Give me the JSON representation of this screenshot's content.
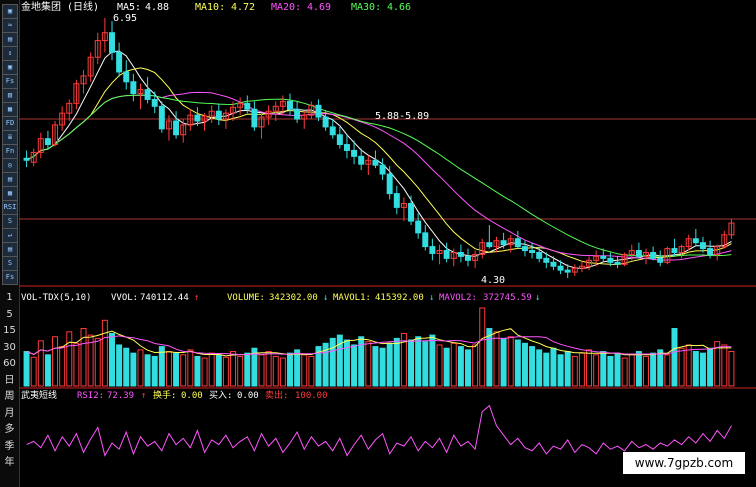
{
  "price_panel": {
    "title": "金地集团 (日线)",
    "ma5_label": "MA5:",
    "ma5_value": "4.88",
    "ma10_label": "MA10:",
    "ma10_value": "4.72",
    "ma20_label": "MA20:",
    "ma20_value": "4.69",
    "ma30_label": "MA30:",
    "ma30_value": "4.66",
    "high_label": "6.95",
    "range_label": "5.88-5.89",
    "low_label": "4.30"
  },
  "volume_panel": {
    "title": "VOL-TDX(5,10)",
    "vvol_label": "VVOL:",
    "vvol_value": "740112.44",
    "volume_label": "VOLUME:",
    "volume_value": "342302.00",
    "mavol1_label": "MAVOL1:",
    "mavol1_value": "415392.00",
    "mavol2_label": "MAVOL2:",
    "mavol2_value": "372745.59",
    "arrow_up": "↑",
    "arrow_down": "↓"
  },
  "indicator_panel": {
    "title": "武夷短线",
    "rsi_label": "RSI2:",
    "rsi_value": "72.39",
    "sw_label": "换手:",
    "sw_value": "0.00",
    "buy_label": "买入:",
    "buy_value": "0.00",
    "sell_label": "卖出:",
    "sell_value": "100.00"
  },
  "toolbar": {
    "buttons": [
      "▣",
      "≈",
      "▤",
      "↕",
      "▣",
      "Fs",
      "▥",
      "▦",
      "FD",
      "≣",
      "Fn",
      "◎",
      "▤",
      "▦",
      "RSI",
      "S",
      "↵",
      "▤",
      "S",
      "Fs"
    ],
    "labels": [
      "1",
      "5",
      "15",
      "30",
      "60",
      "日",
      "周",
      "月",
      "多",
      "季",
      "年"
    ]
  },
  "watermark": "www.7gpzb.com",
  "colors": {
    "up": "#ff3b3b",
    "down": "#33dde0",
    "ma5": "#ffffff",
    "ma10": "#ffff55",
    "ma20": "#ff55ff",
    "ma30": "#55ff55",
    "rsi": "#ff55ff",
    "signal": "#ffff88"
  },
  "chart_data": {
    "type": "candlestick",
    "x": "trading days (no dates printed)",
    "price_range": [
      4.3,
      6.95
    ],
    "candles_ohlc": [
      [
        5.52,
        5.6,
        5.43,
        5.5
      ],
      [
        5.48,
        5.62,
        5.44,
        5.58
      ],
      [
        5.58,
        5.78,
        5.52,
        5.72
      ],
      [
        5.72,
        5.8,
        5.62,
        5.66
      ],
      [
        5.66,
        5.9,
        5.64,
        5.86
      ],
      [
        5.86,
        6.05,
        5.8,
        5.98
      ],
      [
        5.98,
        6.12,
        5.9,
        6.08
      ],
      [
        6.08,
        6.32,
        6.02,
        6.28
      ],
      [
        6.28,
        6.42,
        6.18,
        6.36
      ],
      [
        6.36,
        6.6,
        6.3,
        6.55
      ],
      [
        6.55,
        6.8,
        6.48,
        6.72
      ],
      [
        6.72,
        6.95,
        6.6,
        6.8
      ],
      [
        6.8,
        6.92,
        6.52,
        6.6
      ],
      [
        6.6,
        6.7,
        6.35,
        6.4
      ],
      [
        6.4,
        6.52,
        6.22,
        6.3
      ],
      [
        6.3,
        6.38,
        6.1,
        6.18
      ],
      [
        6.18,
        6.28,
        6.02,
        6.22
      ],
      [
        6.22,
        6.35,
        6.08,
        6.12
      ],
      [
        6.12,
        6.2,
        5.98,
        6.05
      ],
      [
        6.05,
        6.1,
        5.78,
        5.82
      ],
      [
        5.82,
        5.96,
        5.7,
        5.9
      ],
      [
        5.9,
        6.0,
        5.72,
        5.76
      ],
      [
        5.76,
        5.92,
        5.68,
        5.86
      ],
      [
        5.86,
        6.02,
        5.8,
        5.96
      ],
      [
        5.96,
        6.04,
        5.85,
        5.9
      ],
      [
        5.9,
        5.98,
        5.8,
        5.95
      ],
      [
        5.95,
        6.06,
        5.88,
        6.0
      ],
      [
        6.0,
        6.08,
        5.86,
        5.92
      ],
      [
        5.92,
        6.02,
        5.82,
        5.98
      ],
      [
        5.98,
        6.1,
        5.9,
        6.04
      ],
      [
        6.04,
        6.14,
        5.96,
        6.08
      ],
      [
        6.08,
        6.16,
        5.98,
        6.02
      ],
      [
        6.02,
        6.1,
        5.8,
        5.84
      ],
      [
        5.84,
        5.98,
        5.72,
        5.94
      ],
      [
        5.94,
        6.06,
        5.86,
        6.0
      ],
      [
        6.0,
        6.1,
        5.9,
        6.05
      ],
      [
        6.05,
        6.16,
        5.96,
        6.1
      ],
      [
        6.1,
        6.18,
        5.96,
        6.02
      ],
      [
        6.02,
        6.1,
        5.88,
        5.92
      ],
      [
        5.92,
        6.0,
        5.82,
        5.96
      ],
      [
        5.96,
        6.1,
        5.92,
        6.06
      ],
      [
        6.06,
        6.12,
        5.9,
        5.94
      ],
      [
        5.94,
        6.0,
        5.8,
        5.84
      ],
      [
        5.84,
        5.92,
        5.72,
        5.76
      ],
      [
        5.76,
        5.84,
        5.62,
        5.66
      ],
      [
        5.66,
        5.76,
        5.52,
        5.6
      ],
      [
        5.6,
        5.7,
        5.46,
        5.54
      ],
      [
        5.54,
        5.62,
        5.4,
        5.46
      ],
      [
        5.46,
        5.55,
        5.35,
        5.5
      ],
      [
        5.5,
        5.6,
        5.42,
        5.45
      ],
      [
        5.45,
        5.52,
        5.3,
        5.36
      ],
      [
        5.36,
        5.44,
        5.1,
        5.16
      ],
      [
        5.16,
        5.24,
        4.95,
        5.02
      ],
      [
        5.02,
        5.12,
        4.88,
        5.06
      ],
      [
        5.06,
        5.14,
        4.84,
        4.88
      ],
      [
        4.88,
        4.96,
        4.7,
        4.76
      ],
      [
        4.76,
        4.84,
        4.58,
        4.62
      ],
      [
        4.62,
        4.7,
        4.48,
        4.55
      ],
      [
        4.55,
        4.64,
        4.44,
        4.58
      ],
      [
        4.58,
        4.66,
        4.46,
        4.5
      ],
      [
        4.5,
        4.6,
        4.42,
        4.56
      ],
      [
        4.56,
        4.64,
        4.46,
        4.52
      ],
      [
        4.52,
        4.6,
        4.42,
        4.48
      ],
      [
        4.48,
        4.58,
        4.4,
        4.54
      ],
      [
        4.54,
        4.7,
        4.5,
        4.66
      ],
      [
        4.66,
        4.84,
        4.6,
        4.62
      ],
      [
        4.62,
        4.72,
        4.56,
        4.68
      ],
      [
        4.68,
        4.76,
        4.6,
        4.64
      ],
      [
        4.64,
        4.74,
        4.56,
        4.7
      ],
      [
        4.7,
        4.78,
        4.6,
        4.62
      ],
      [
        4.62,
        4.68,
        4.52,
        4.58
      ],
      [
        4.58,
        4.66,
        4.5,
        4.56
      ],
      [
        4.56,
        4.62,
        4.46,
        4.5
      ],
      [
        4.5,
        4.56,
        4.4,
        4.46
      ],
      [
        4.46,
        4.52,
        4.38,
        4.42
      ],
      [
        4.42,
        4.48,
        4.34,
        4.38
      ],
      [
        4.38,
        4.44,
        4.3,
        4.36
      ],
      [
        4.36,
        4.44,
        4.32,
        4.4
      ],
      [
        4.4,
        4.48,
        4.36,
        4.42
      ],
      [
        4.42,
        4.52,
        4.38,
        4.48
      ],
      [
        4.48,
        4.58,
        4.42,
        4.52
      ],
      [
        4.52,
        4.6,
        4.46,
        4.5
      ],
      [
        4.5,
        4.56,
        4.42,
        4.46
      ],
      [
        4.46,
        4.52,
        4.4,
        4.44
      ],
      [
        4.44,
        4.56,
        4.42,
        4.54
      ],
      [
        4.54,
        4.64,
        4.48,
        4.58
      ],
      [
        4.58,
        4.66,
        4.5,
        4.52
      ],
      [
        4.52,
        4.6,
        4.44,
        4.56
      ],
      [
        4.56,
        4.62,
        4.48,
        4.5
      ],
      [
        4.5,
        4.58,
        4.42,
        4.46
      ],
      [
        4.46,
        4.62,
        4.44,
        4.6
      ],
      [
        4.6,
        4.7,
        4.52,
        4.56
      ],
      [
        4.56,
        4.64,
        4.5,
        4.62
      ],
      [
        4.62,
        4.74,
        4.58,
        4.7
      ],
      [
        4.7,
        4.8,
        4.62,
        4.66
      ],
      [
        4.66,
        4.72,
        4.56,
        4.6
      ],
      [
        4.6,
        4.68,
        4.5,
        4.54
      ],
      [
        4.54,
        4.64,
        4.48,
        4.62
      ],
      [
        4.62,
        4.78,
        4.6,
        4.74
      ],
      [
        4.74,
        4.9,
        4.7,
        4.86
      ]
    ],
    "volume": [
      42,
      35,
      55,
      38,
      60,
      48,
      66,
      52,
      70,
      62,
      58,
      80,
      64,
      50,
      46,
      40,
      44,
      38,
      36,
      48,
      42,
      40,
      38,
      44,
      36,
      34,
      40,
      38,
      35,
      42,
      36,
      40,
      46,
      38,
      42,
      36,
      34,
      40,
      44,
      38,
      36,
      48,
      52,
      58,
      62,
      56,
      50,
      60,
      54,
      48,
      46,
      52,
      58,
      64,
      56,
      60,
      54,
      62,
      50,
      46,
      52,
      48,
      44,
      50,
      95,
      70,
      66,
      58,
      60,
      56,
      52,
      48,
      44,
      40,
      46,
      38,
      42,
      36,
      40,
      44,
      38,
      42,
      36,
      40,
      34,
      38,
      42,
      36,
      40,
      44,
      38,
      70,
      46,
      50,
      42,
      40,
      46,
      54,
      50,
      42
    ],
    "rsi2": [
      48,
      52,
      44,
      60,
      40,
      58,
      46,
      62,
      38,
      55,
      70,
      34,
      50,
      42,
      64,
      36,
      58,
      46,
      52,
      40,
      62,
      48,
      56,
      44,
      66,
      38,
      54,
      48,
      60,
      44,
      52,
      58,
      40,
      62,
      46,
      56,
      38,
      50,
      64,
      42,
      58,
      46,
      52,
      40,
      56,
      34,
      48,
      60,
      42,
      54,
      62,
      36,
      50,
      46,
      58,
      40,
      52,
      44,
      56,
      38,
      60,
      46,
      52,
      42,
      90,
      98,
      72,
      60,
      48,
      56,
      44,
      40,
      50,
      36,
      46,
      42,
      54,
      38,
      48,
      44,
      36,
      50,
      42,
      46,
      40,
      52,
      44,
      48,
      42,
      50,
      46,
      54,
      48,
      58,
      50,
      62,
      52,
      66,
      56,
      72
    ]
  }
}
